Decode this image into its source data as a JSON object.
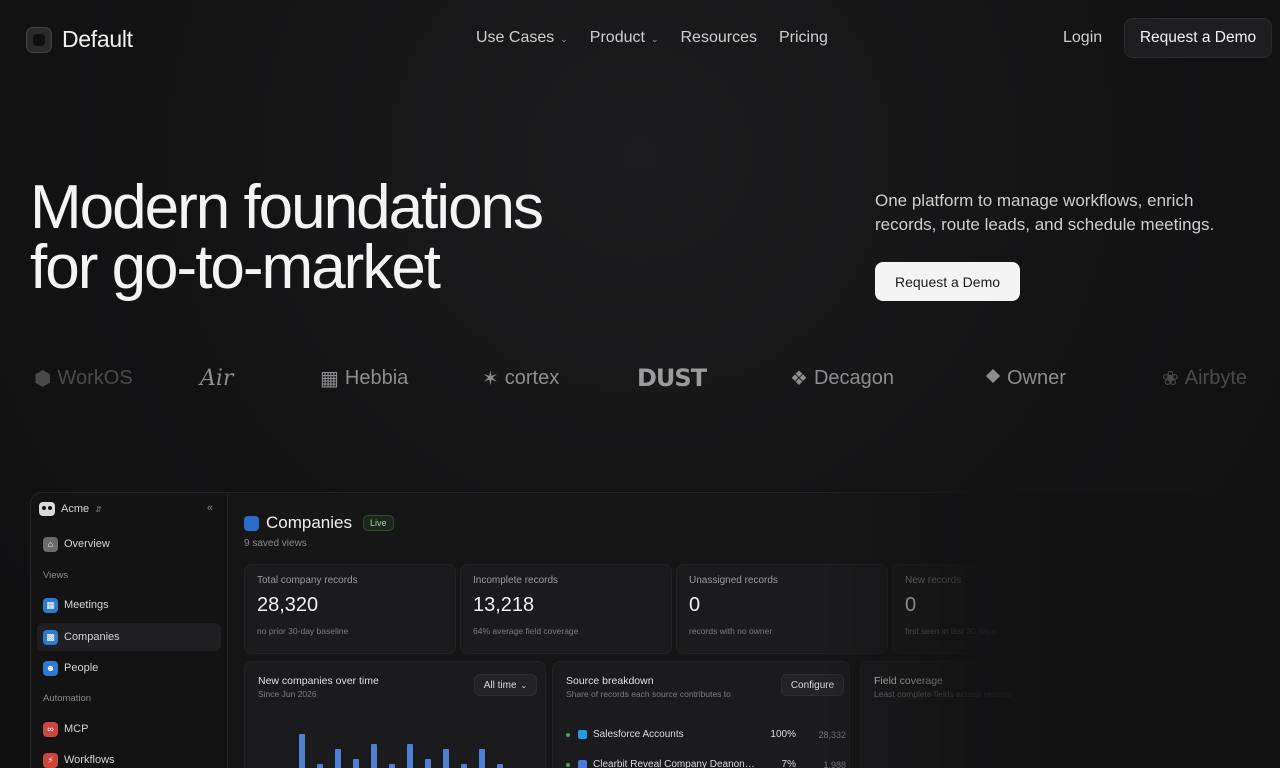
{
  "brand": {
    "name": "Default"
  },
  "nav": {
    "links": [
      {
        "label": "Use Cases",
        "has_dropdown": true
      },
      {
        "label": "Product",
        "has_dropdown": true
      },
      {
        "label": "Resources",
        "has_dropdown": false
      },
      {
        "label": "Pricing",
        "has_dropdown": false
      }
    ],
    "login": "Login",
    "cta": "Request a Demo"
  },
  "hero": {
    "title_line1": "Modern foundations",
    "title_line2": "for go-to-market",
    "subtitle": "One platform to manage workflows, enrich records, route leads, and schedule meetings.",
    "cta": "Request a Demo"
  },
  "logos": [
    "WorkOS",
    "Air",
    "Hebbia",
    "cortex",
    "DUST",
    "Decagon",
    "Owner",
    "Airbyte"
  ],
  "app": {
    "workspace": "Acme",
    "sidebar": {
      "overview": "Overview",
      "views_label": "Views",
      "views": [
        "Meetings",
        "Companies",
        "People"
      ],
      "automation_label": "Automation",
      "automation": [
        "MCP",
        "Workflows"
      ]
    },
    "page": {
      "title": "Companies",
      "badge": "Live",
      "saved_views": "9 saved views"
    },
    "stats": [
      {
        "label": "Total company records",
        "value": "28,320",
        "sub": "no prior 30-day baseline"
      },
      {
        "label": "Incomplete records",
        "value": "13,218",
        "sub": "64% average field coverage"
      },
      {
        "label": "Unassigned records",
        "value": "0",
        "sub": "records with no owner"
      },
      {
        "label": "New records",
        "value": "0",
        "sub": "first seen in last 30 days"
      }
    ],
    "chart_card": {
      "title": "New companies over time",
      "subtitle": "Since Jun 2026",
      "filter": "All time"
    },
    "source_card": {
      "title": "Source breakdown",
      "subtitle": "Share of records each source contributes to",
      "configure": "Configure",
      "rows": [
        {
          "name": "Salesforce Accounts",
          "pct": "100%",
          "count": "28,332",
          "color": "#1f9be0"
        },
        {
          "name": "Clearbit Reveal Company Deanonymi...",
          "pct": "7%",
          "count": "1,988",
          "color": "#4a79d6"
        }
      ]
    },
    "coverage_card": {
      "title": "Field coverage",
      "subtitle": "Least complete fields across records"
    }
  },
  "chart_data": {
    "type": "bar",
    "title": "New companies over time",
    "values": [
      1,
      8,
      2,
      5,
      3,
      6,
      2,
      6,
      3,
      5,
      2,
      5,
      2,
      1
    ]
  },
  "colors": {
    "background": "#111112",
    "accent_blue": "#4f7fd0",
    "live_green": "#9fd59f"
  }
}
